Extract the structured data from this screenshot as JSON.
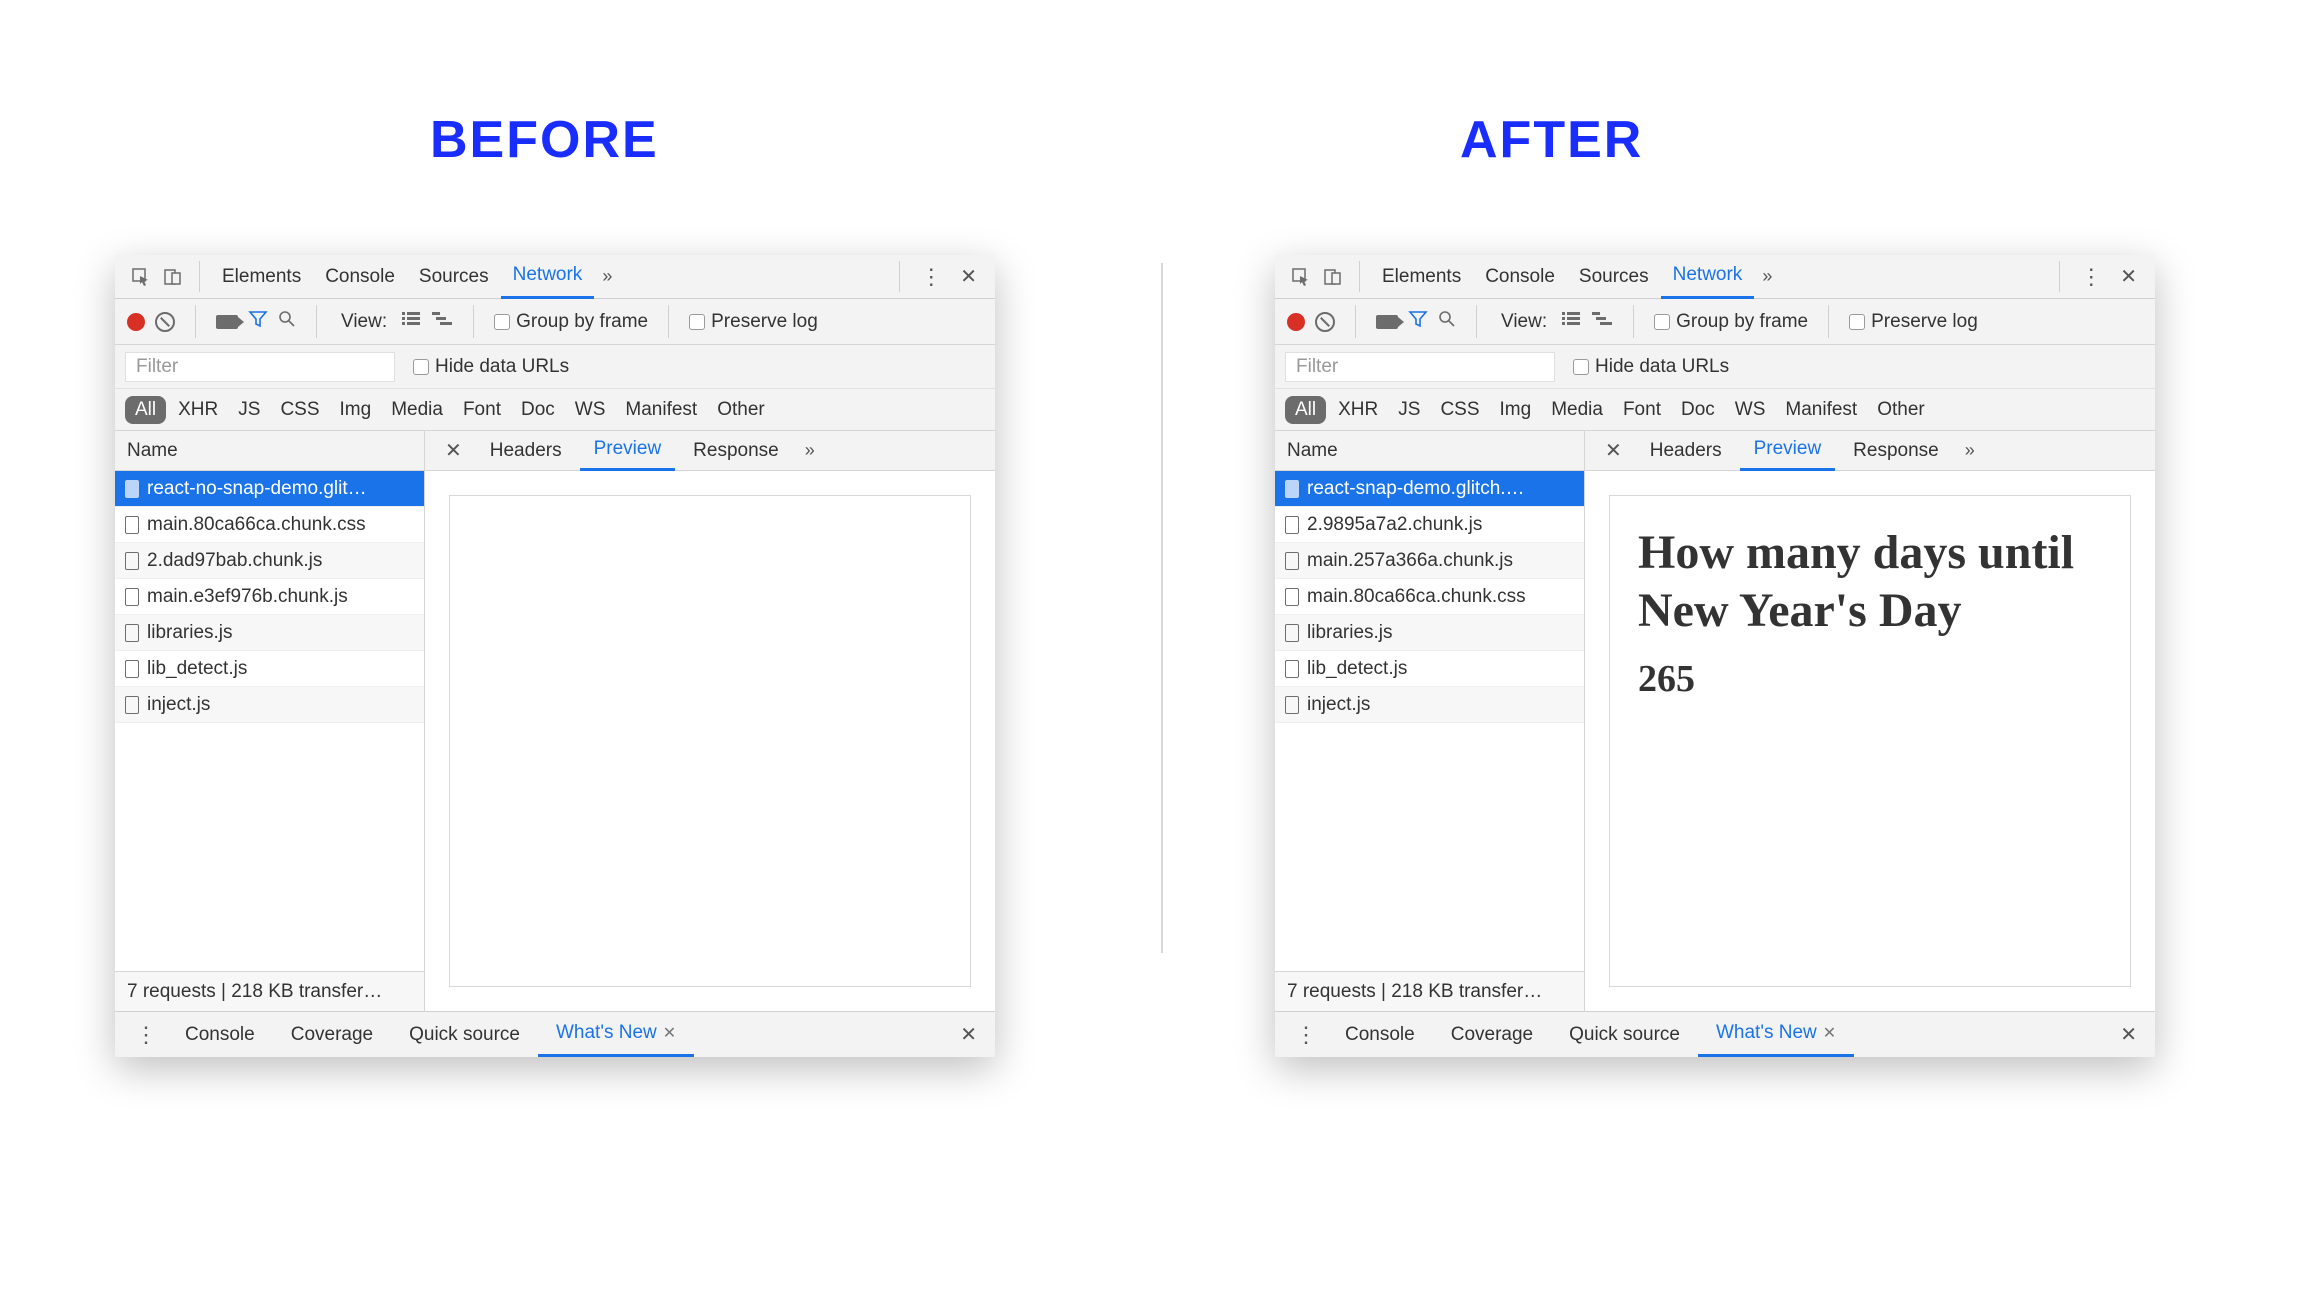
{
  "headings": {
    "before": "BEFORE",
    "after": "AFTER"
  },
  "topTabs": [
    "Elements",
    "Console",
    "Sources",
    "Network"
  ],
  "topTabsActive": "Network",
  "toolbar": {
    "viewLabel": "View:",
    "groupByFrame": "Group by frame",
    "preserveLog": "Preserve log"
  },
  "filter": {
    "placeholder": "Filter",
    "hideDataUrls": "Hide data URLs"
  },
  "filterTypes": [
    "All",
    "XHR",
    "JS",
    "CSS",
    "Img",
    "Media",
    "Font",
    "Doc",
    "WS",
    "Manifest",
    "Other"
  ],
  "filterTypesActive": "All",
  "columns": {
    "name": "Name"
  },
  "subTabs": [
    "Headers",
    "Preview",
    "Response"
  ],
  "subTabsActive": "Preview",
  "panels": {
    "before": {
      "requests": [
        "react-no-snap-demo.glit…",
        "main.80ca66ca.chunk.css",
        "2.dad97bab.chunk.js",
        "main.e3ef976b.chunk.js",
        "libraries.js",
        "lib_detect.js",
        "inject.js"
      ],
      "selectedIndex": 0,
      "preview": {
        "heading": "",
        "count": ""
      },
      "status": "7 requests | 218 KB transfer…"
    },
    "after": {
      "requests": [
        "react-snap-demo.glitch.…",
        "2.9895a7a2.chunk.js",
        "main.257a366a.chunk.js",
        "main.80ca66ca.chunk.css",
        "libraries.js",
        "lib_detect.js",
        "inject.js"
      ],
      "selectedIndex": 0,
      "preview": {
        "heading": "How many days until New Year's Day",
        "count": "265"
      },
      "status": "7 requests | 218 KB transfer…"
    }
  },
  "drawerTabs": [
    "Console",
    "Coverage",
    "Quick source",
    "What's New"
  ],
  "drawerActive": "What's New"
}
